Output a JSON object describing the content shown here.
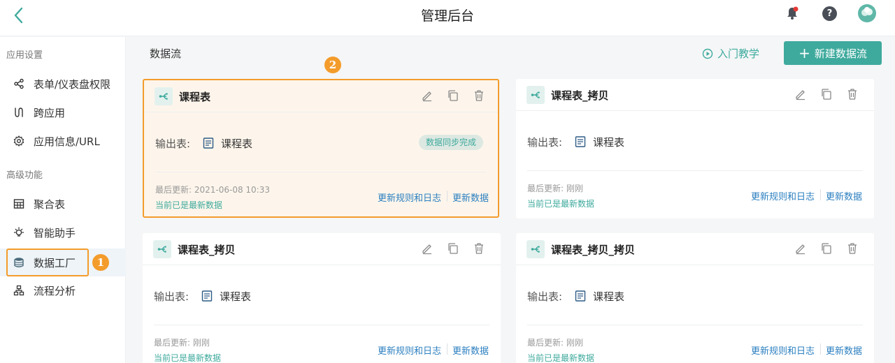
{
  "header": {
    "title": "管理后台"
  },
  "sidebar": {
    "sections": [
      {
        "label": "应用设置"
      },
      {
        "label": "高级功能"
      }
    ],
    "items": [
      {
        "label": "表单/仪表盘权限",
        "icon": "share-icon"
      },
      {
        "label": "跨应用",
        "icon": "cross-app-icon"
      },
      {
        "label": "应用信息/URL",
        "icon": "gear-icon"
      },
      {
        "label": "聚合表",
        "icon": "table-grid-icon"
      },
      {
        "label": "智能助手",
        "icon": "bulb-icon"
      },
      {
        "label": "数据工厂",
        "icon": "database-icon"
      },
      {
        "label": "流程分析",
        "icon": "org-chart-icon"
      }
    ],
    "marker": "1"
  },
  "main": {
    "title": "数据流",
    "tutorial_label": "入门教学",
    "new_button_label": "新建数据流",
    "marker": "2"
  },
  "cards": [
    {
      "name": "课程表",
      "output_label": "输出表:",
      "output_table": "课程表",
      "badge": "数据同步完成",
      "updated": "最后更新: 2021-06-08 10:33",
      "status": "当前已是最新数据",
      "log_link": "更新规则和日志",
      "update_link": "更新数据"
    },
    {
      "name": "课程表_拷贝",
      "output_label": "输出表:",
      "output_table": "课程表",
      "updated": "最后更新: 刚刚",
      "status": "当前已是最新数据",
      "log_link": "更新规则和日志",
      "update_link": "更新数据"
    },
    {
      "name": "课程表_拷贝",
      "output_label": "输出表:",
      "output_table": "课程表",
      "updated": "最后更新: 刚刚",
      "status": "当前已是最新数据",
      "log_link": "更新规则和日志",
      "update_link": "更新数据"
    },
    {
      "name": "课程表_拷贝_拷贝",
      "output_label": "输出表:",
      "output_table": "课程表",
      "updated": "最后更新: 刚刚",
      "status": "当前已是最新数据",
      "log_link": "更新规则和日志",
      "update_link": "更新数据"
    }
  ],
  "colors": {
    "accent": "#3eaa9d",
    "highlight": "#f39c2b",
    "link": "#2b7fc0"
  }
}
